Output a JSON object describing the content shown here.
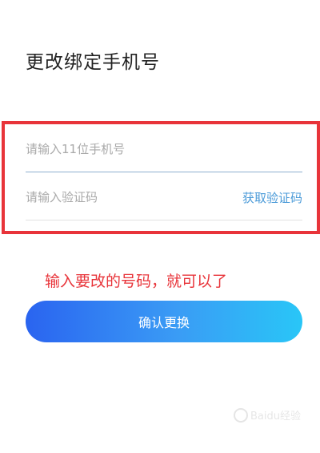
{
  "header": {
    "title": "更改绑定手机号"
  },
  "form": {
    "phone_placeholder": "请输入11位手机号",
    "code_placeholder": "请输入验证码",
    "get_code_label": "获取验证码"
  },
  "annotation": {
    "text": "输入要改的号码，就可以了",
    "color": "#e8343a"
  },
  "actions": {
    "confirm_label": "确认更换"
  },
  "watermark": {
    "text": "Baidu经验",
    "icon": "baidu-paw-icon"
  },
  "colors": {
    "accent_start": "#2a64f0",
    "accent_end": "#29c6f7",
    "link": "#4a9ad8",
    "highlight": "#e8343a"
  }
}
